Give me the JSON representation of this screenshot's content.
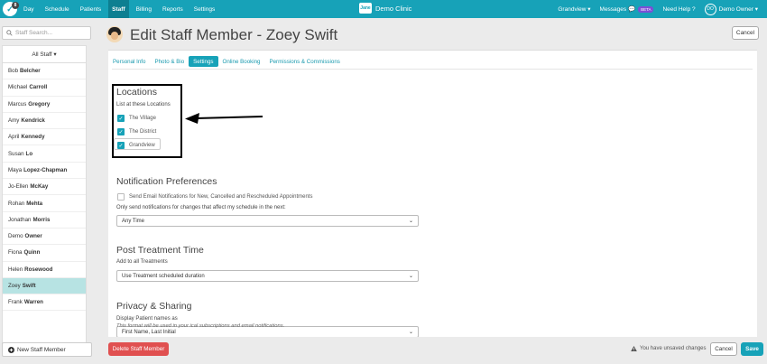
{
  "topnav": {
    "logo_badge": "8",
    "items": [
      "Day",
      "Schedule",
      "Patients",
      "Staff",
      "Billing",
      "Reports",
      "Settings"
    ],
    "active": "Staff",
    "clinic_icon_text": "Jane",
    "clinic_name": "Demo Clinic",
    "location": "Grandview",
    "messages": "Messages",
    "beta": "BETA",
    "help": "Need Help ?",
    "user_initials": "DO",
    "user_name": "Demo Owner"
  },
  "sidebar": {
    "search_placeholder": "Staff Search...",
    "filter_label": "All Staff",
    "staff": [
      {
        "first": "Bob",
        "last": "Belcher"
      },
      {
        "first": "Michael",
        "last": "Carroll"
      },
      {
        "first": "Marcus",
        "last": "Gregory"
      },
      {
        "first": "Amy",
        "last": "Kendrick"
      },
      {
        "first": "April",
        "last": "Kennedy"
      },
      {
        "first": "Susan",
        "last": "Lo"
      },
      {
        "first": "Maya",
        "last": "Lopez-Chapman"
      },
      {
        "first": "Jo-Ellen",
        "last": "McKay"
      },
      {
        "first": "Rohan",
        "last": "Mehta"
      },
      {
        "first": "Jonathan",
        "last": "Morris"
      },
      {
        "first": "Demo",
        "last": "Owner"
      },
      {
        "first": "Fiona",
        "last": "Quinn"
      },
      {
        "first": "Helen",
        "last": "Rosewood"
      },
      {
        "first": "Zoey",
        "last": "Swift"
      },
      {
        "first": "Frank",
        "last": "Warren"
      }
    ],
    "selected_index": 13,
    "new_staff_label": "New Staff Member"
  },
  "header": {
    "title": "Edit Staff Member - Zoey Swift",
    "cancel_label": "Cancel"
  },
  "tabs": {
    "items": [
      "Personal Info",
      "Photo & Bio",
      "Settings",
      "Online Booking",
      "Permissions & Commissions"
    ],
    "active": "Settings"
  },
  "locations": {
    "title": "Locations",
    "subtitle": "List at these Locations",
    "items": [
      {
        "label": "The Village",
        "checked": true
      },
      {
        "label": "The District",
        "checked": true
      },
      {
        "label": "Grandview",
        "checked": true
      }
    ]
  },
  "notifications": {
    "title": "Notification Preferences",
    "checkbox_label": "Send Email Notifications for New, Cancelled and Rescheduled Appointments",
    "checkbox_checked": false,
    "hint": "Only send notifications for changes that affect my schedule in the next:",
    "select_value": "Any Time"
  },
  "post_treatment": {
    "title": "Post Treatment Time",
    "hint": "Add to all Treatments",
    "select_value": "Use Treatment scheduled duration"
  },
  "privacy": {
    "title": "Privacy & Sharing",
    "hint": "Display Patient names as",
    "select_value": "First Name, Last Initial",
    "note": "This format will be used in your ical subscriptions and email notifications."
  },
  "footer": {
    "delete_label": "Delete Staff Member",
    "unsaved_label": "You have unsaved changes",
    "cancel_label": "Cancel",
    "save_label": "Save"
  },
  "colors": {
    "brand": "#17a2b8",
    "danger": "#e05050",
    "selected_row": "#b7e3e3"
  }
}
